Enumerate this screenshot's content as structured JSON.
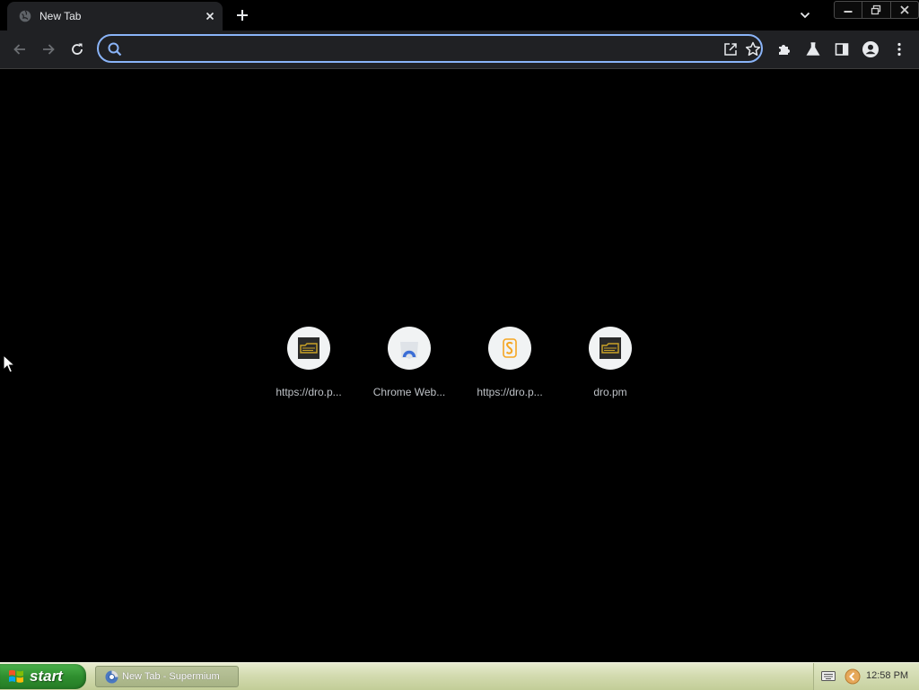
{
  "browser": {
    "tab": {
      "title": "New Tab"
    },
    "omnibox": {
      "value": "",
      "placeholder": ""
    }
  },
  "new_tab_page": {
    "shortcuts": [
      {
        "label": "https://dro.p...",
        "icon": "dro-pm-favicon"
      },
      {
        "label": "Chrome Web...",
        "icon": "chrome-web-store-icon"
      },
      {
        "label": "https://dro.p...",
        "icon": "orange-s-favicon"
      },
      {
        "label": "dro.pm",
        "icon": "dro-pm-favicon"
      }
    ]
  },
  "taskbar": {
    "start_label": "start",
    "window_button_label": "New Tab - Supermium",
    "clock": "12:58 PM"
  },
  "colors": {
    "omnibox_focus_ring": "#8ab4f8",
    "page_background": "#000000",
    "toolbar_background": "#202124",
    "start_button": "#2f8f2f",
    "taskbar": "#d3dbb0"
  }
}
